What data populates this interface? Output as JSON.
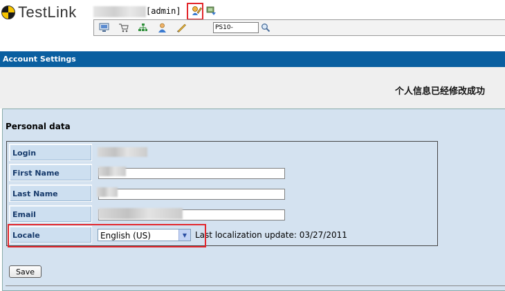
{
  "header": {
    "logo_text": "TestLink",
    "user_role": "[admin]",
    "icons": [
      "edit-user-icon",
      "logout-icon"
    ]
  },
  "toolbar": {
    "icons": [
      "desktop-icon",
      "requirements-icon",
      "test-plan-icon",
      "user-icon",
      "events-icon",
      "search-icon"
    ],
    "search_value": "PS10-"
  },
  "page": {
    "title": "Account Settings",
    "status_message": "个人信息已经修改成功"
  },
  "personal_data": {
    "section_title": "Personal data",
    "fields": [
      {
        "label": "Login",
        "value": ""
      },
      {
        "label": "First Name",
        "value": ""
      },
      {
        "label": "Last Name",
        "value": ""
      },
      {
        "label": "Email",
        "value": ""
      },
      {
        "label": "Locale",
        "value": "English (US)"
      }
    ],
    "locale_update_text": "Last localization update: 03/27/2011",
    "save_label": "Save"
  },
  "colors": {
    "title_bar": "#0a5fa0",
    "workarea": "#d4e2f0",
    "label_text": "#163a6b",
    "highlight": "#e3262b"
  }
}
